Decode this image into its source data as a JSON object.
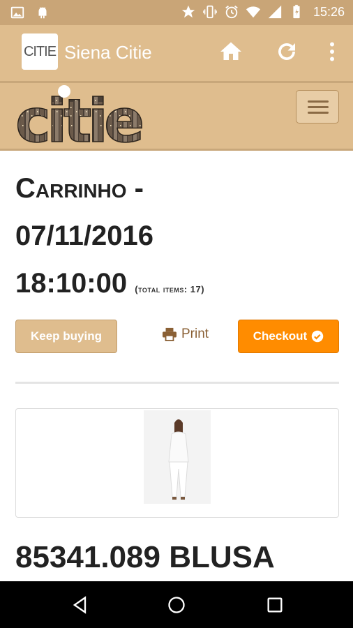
{
  "status_bar": {
    "time": "15:26",
    "icons": [
      "image-icon",
      "android-icon",
      "star-icon",
      "vibrate-icon",
      "alarm-icon",
      "wifi-icon",
      "signal-icon",
      "battery-icon"
    ]
  },
  "app_bar": {
    "logo_text": "CITIE",
    "title": "Siena Citie",
    "actions": [
      "home-icon",
      "refresh-icon",
      "overflow-menu-icon"
    ]
  },
  "site_header": {
    "brand_text": "citie",
    "menu_icon": "hamburger-icon"
  },
  "cart": {
    "label": "Carrinho -",
    "date": "07/11/2016",
    "time": "18:10:00",
    "total_items": "(total items: 17)"
  },
  "actions": {
    "keep_buying": "Keep buying",
    "print": "Print",
    "checkout": "Checkout"
  },
  "product": {
    "title": "85341.089 BLUSA"
  },
  "colors": {
    "status_bar": "#c9a577",
    "app_bar": "#dfbd8e",
    "checkout": "#ff8c00",
    "print_text": "#8a6035"
  },
  "nav_bar": [
    "back-icon",
    "home-circle-icon",
    "recents-icon"
  ]
}
